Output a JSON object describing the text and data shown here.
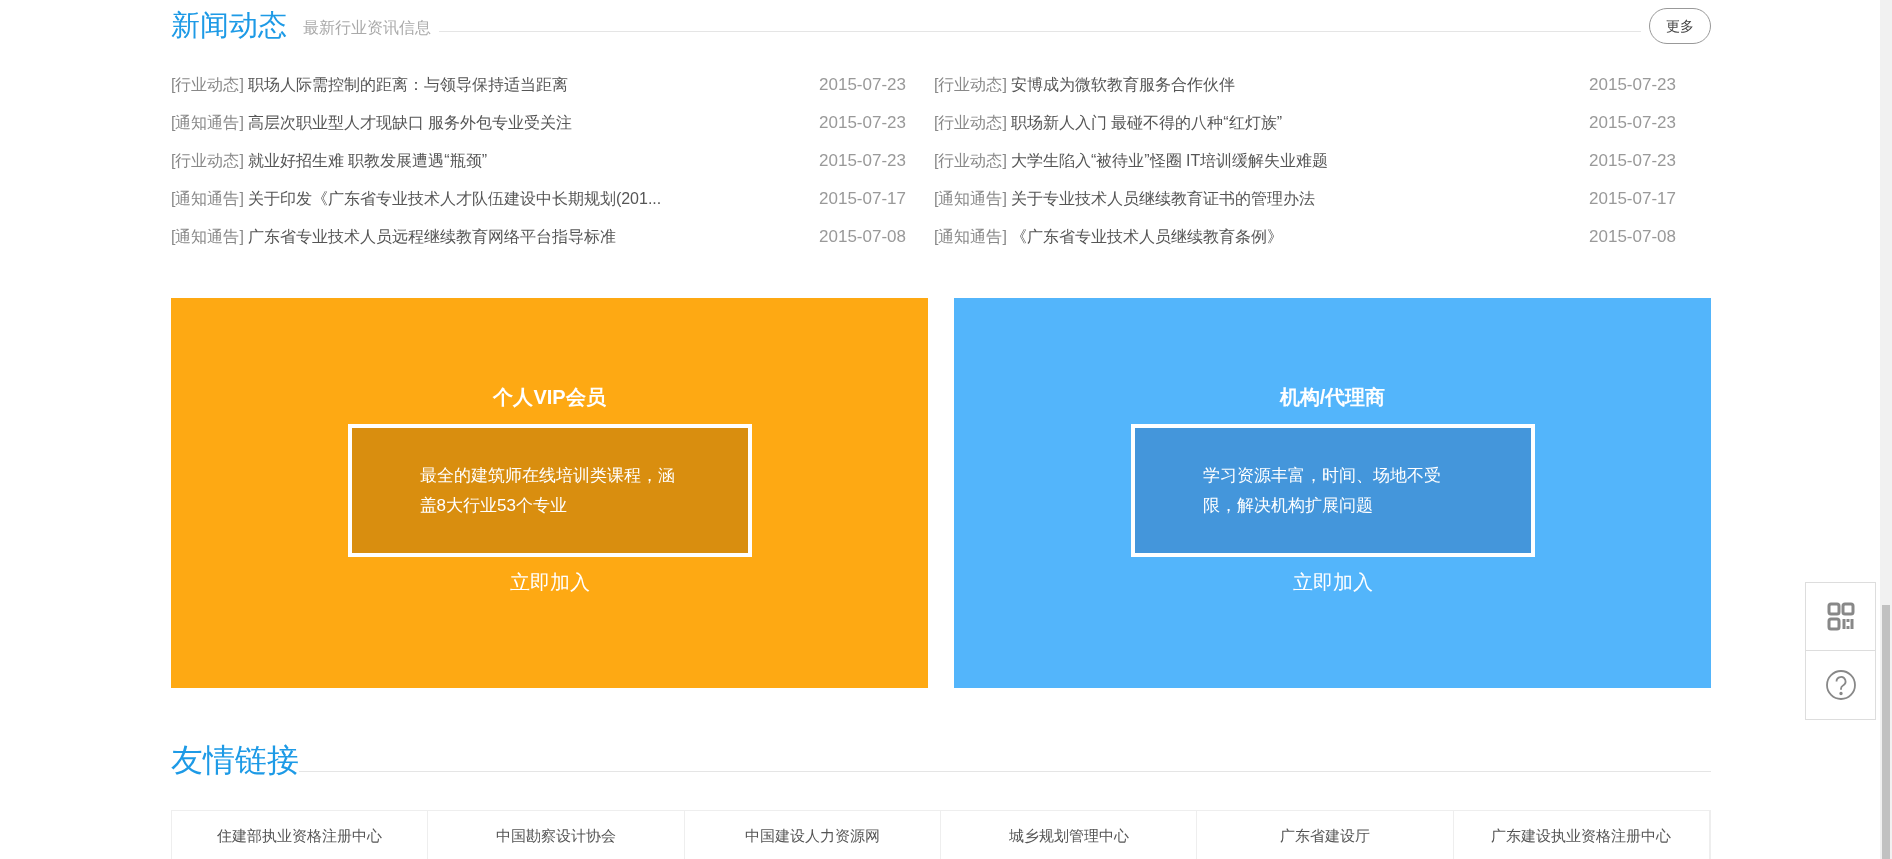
{
  "news": {
    "title": "新闻动态",
    "subtitle": "最新行业资讯信息",
    "more_button": "更多",
    "columns": [
      [
        {
          "category": "[行业动态]",
          "title": "职场人际需控制的距离：与领导保持适当距离",
          "date": "2015-07-23"
        },
        {
          "category": "[通知通告]",
          "title": "高层次职业型人才现缺口 服务外包专业受关注",
          "date": "2015-07-23"
        },
        {
          "category": "[行业动态]",
          "title": "就业好招生难 职教发展遭遇“瓶颈”",
          "date": "2015-07-23"
        },
        {
          "category": "[通知通告]",
          "title": "关于印发《广东省专业技术人才队伍建设中长期规划(201...",
          "date": "2015-07-17"
        },
        {
          "category": "[通知通告]",
          "title": "广东省专业技术人员远程继续教育网络平台指导标准",
          "date": "2015-07-08"
        }
      ],
      [
        {
          "category": "[行业动态]",
          "title": "安博成为微软教育服务合作伙伴",
          "date": "2015-07-23"
        },
        {
          "category": "[行业动态]",
          "title": "职场新人入门 最碰不得的八种“红灯族”",
          "date": "2015-07-23"
        },
        {
          "category": "[行业动态]",
          "title": "大学生陷入“被待业”怪圈 IT培训缓解失业难题",
          "date": "2015-07-23"
        },
        {
          "category": "[通知通告]",
          "title": "关于专业技术人员继续教育证书的管理办法",
          "date": "2015-07-17"
        },
        {
          "category": "[通知通告]",
          "title": "《广东省专业技术人员继续教育条例》",
          "date": "2015-07-08"
        }
      ]
    ]
  },
  "membership_cards": [
    {
      "kind": "personal",
      "title": "个人VIP会员",
      "description": "最全的建筑师在线培训类课程，涵盖8大行业53个专业",
      "action": "立即加入"
    },
    {
      "kind": "agency",
      "title": "机构/代理商",
      "description": "学习资源丰富，时间、场地不受限，解决机构扩展问题",
      "action": "立即加入"
    }
  ],
  "friend_links": {
    "title": "友情链接",
    "items": [
      "住建部执业资格注册中心",
      "中国勘察设计协会",
      "中国建设人力资源网",
      "城乡规划管理中心",
      "广东省建设厅",
      "广东建设执业资格注册中心"
    ]
  }
}
